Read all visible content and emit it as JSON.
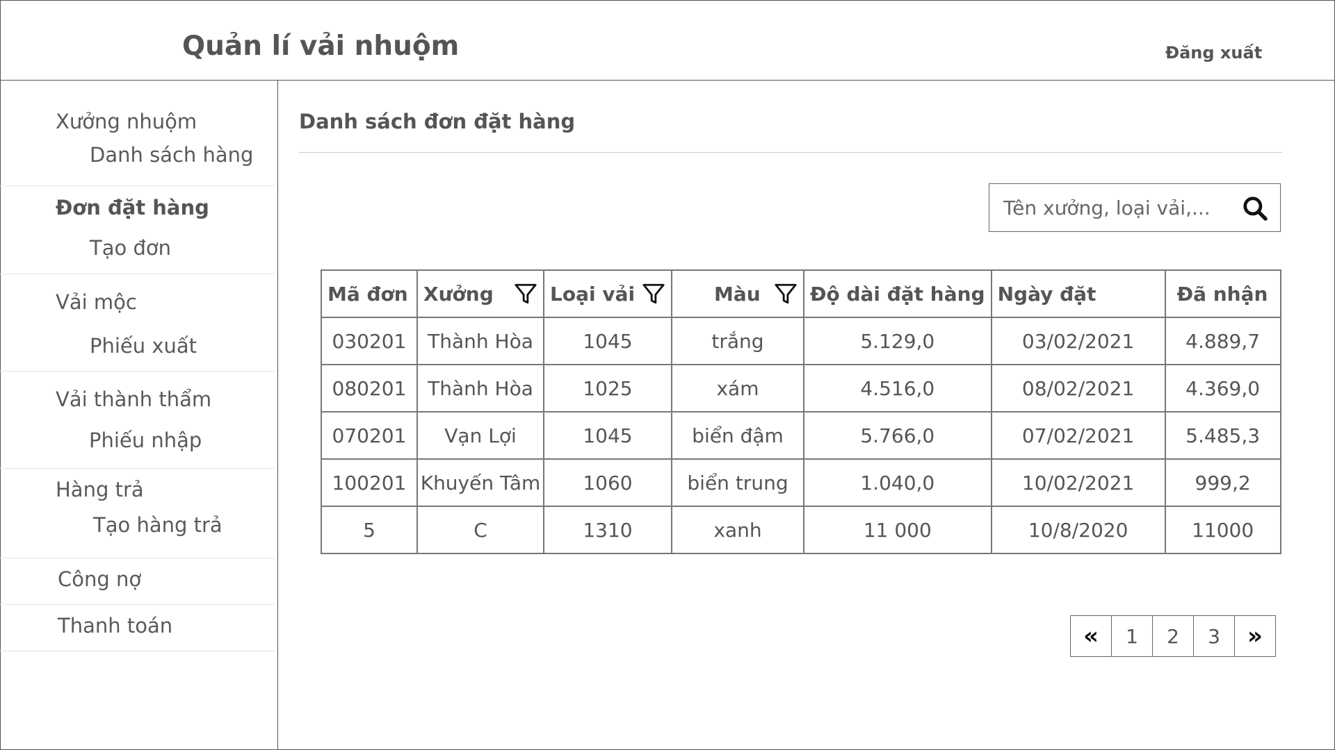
{
  "header": {
    "app_title": "Quản lí vải nhuộm",
    "logout_label": "Đăng xuất"
  },
  "sidebar": {
    "groups": [
      {
        "label": "Xưởng nhuộm",
        "sub": "Danh sách hàng",
        "active": false
      },
      {
        "label": "Đơn đặt hàng",
        "sub": "Tạo đơn",
        "active": true
      },
      {
        "label": "Vải mộc",
        "sub": "Phiếu xuất",
        "active": false
      },
      {
        "label": "Vải thành thẩm",
        "sub": "Phiếu nhập",
        "active": false
      },
      {
        "label": "Hàng trả",
        "sub": "Tạo hàng trả",
        "active": false
      },
      {
        "label": "Công nợ",
        "sub": "",
        "active": false
      },
      {
        "label": "Thanh toán",
        "sub": "",
        "active": false
      }
    ]
  },
  "main": {
    "page_title": "Danh sách đơn đặt hàng",
    "search": {
      "placeholder": "Tên xưởng, loại vải,..."
    },
    "table": {
      "headers": [
        "Mã đơn",
        "Xưởng",
        "Loại vải",
        "Màu",
        "Độ dài đặt hàng",
        "Ngày đặt",
        "Đã nhận"
      ],
      "filterable": [
        false,
        true,
        true,
        true,
        false,
        false,
        false
      ],
      "rows": [
        [
          "030201",
          "Thành Hòa",
          "1045",
          "trắng",
          "5.129,0",
          "03/02/2021",
          "4.889,7"
        ],
        [
          "080201",
          "Thành Hòa",
          "1025",
          "xám",
          "4.516,0",
          "08/02/2021",
          "4.369,0"
        ],
        [
          "070201",
          "Vạn Lợi",
          "1045",
          "biển đậm",
          "5.766,0",
          "07/02/2021",
          "5.485,3"
        ],
        [
          "100201",
          "Khuyến Tâm",
          "1060",
          "biển trung",
          "1.040,0",
          "10/02/2021",
          "999,2"
        ],
        [
          "5",
          "C",
          "1310",
          "xanh",
          "11 000",
          "10/8/2020",
          "11000"
        ]
      ]
    },
    "pagination": {
      "first_label": "«",
      "pages": [
        "1",
        "2",
        "3"
      ],
      "last_label": "»"
    }
  }
}
